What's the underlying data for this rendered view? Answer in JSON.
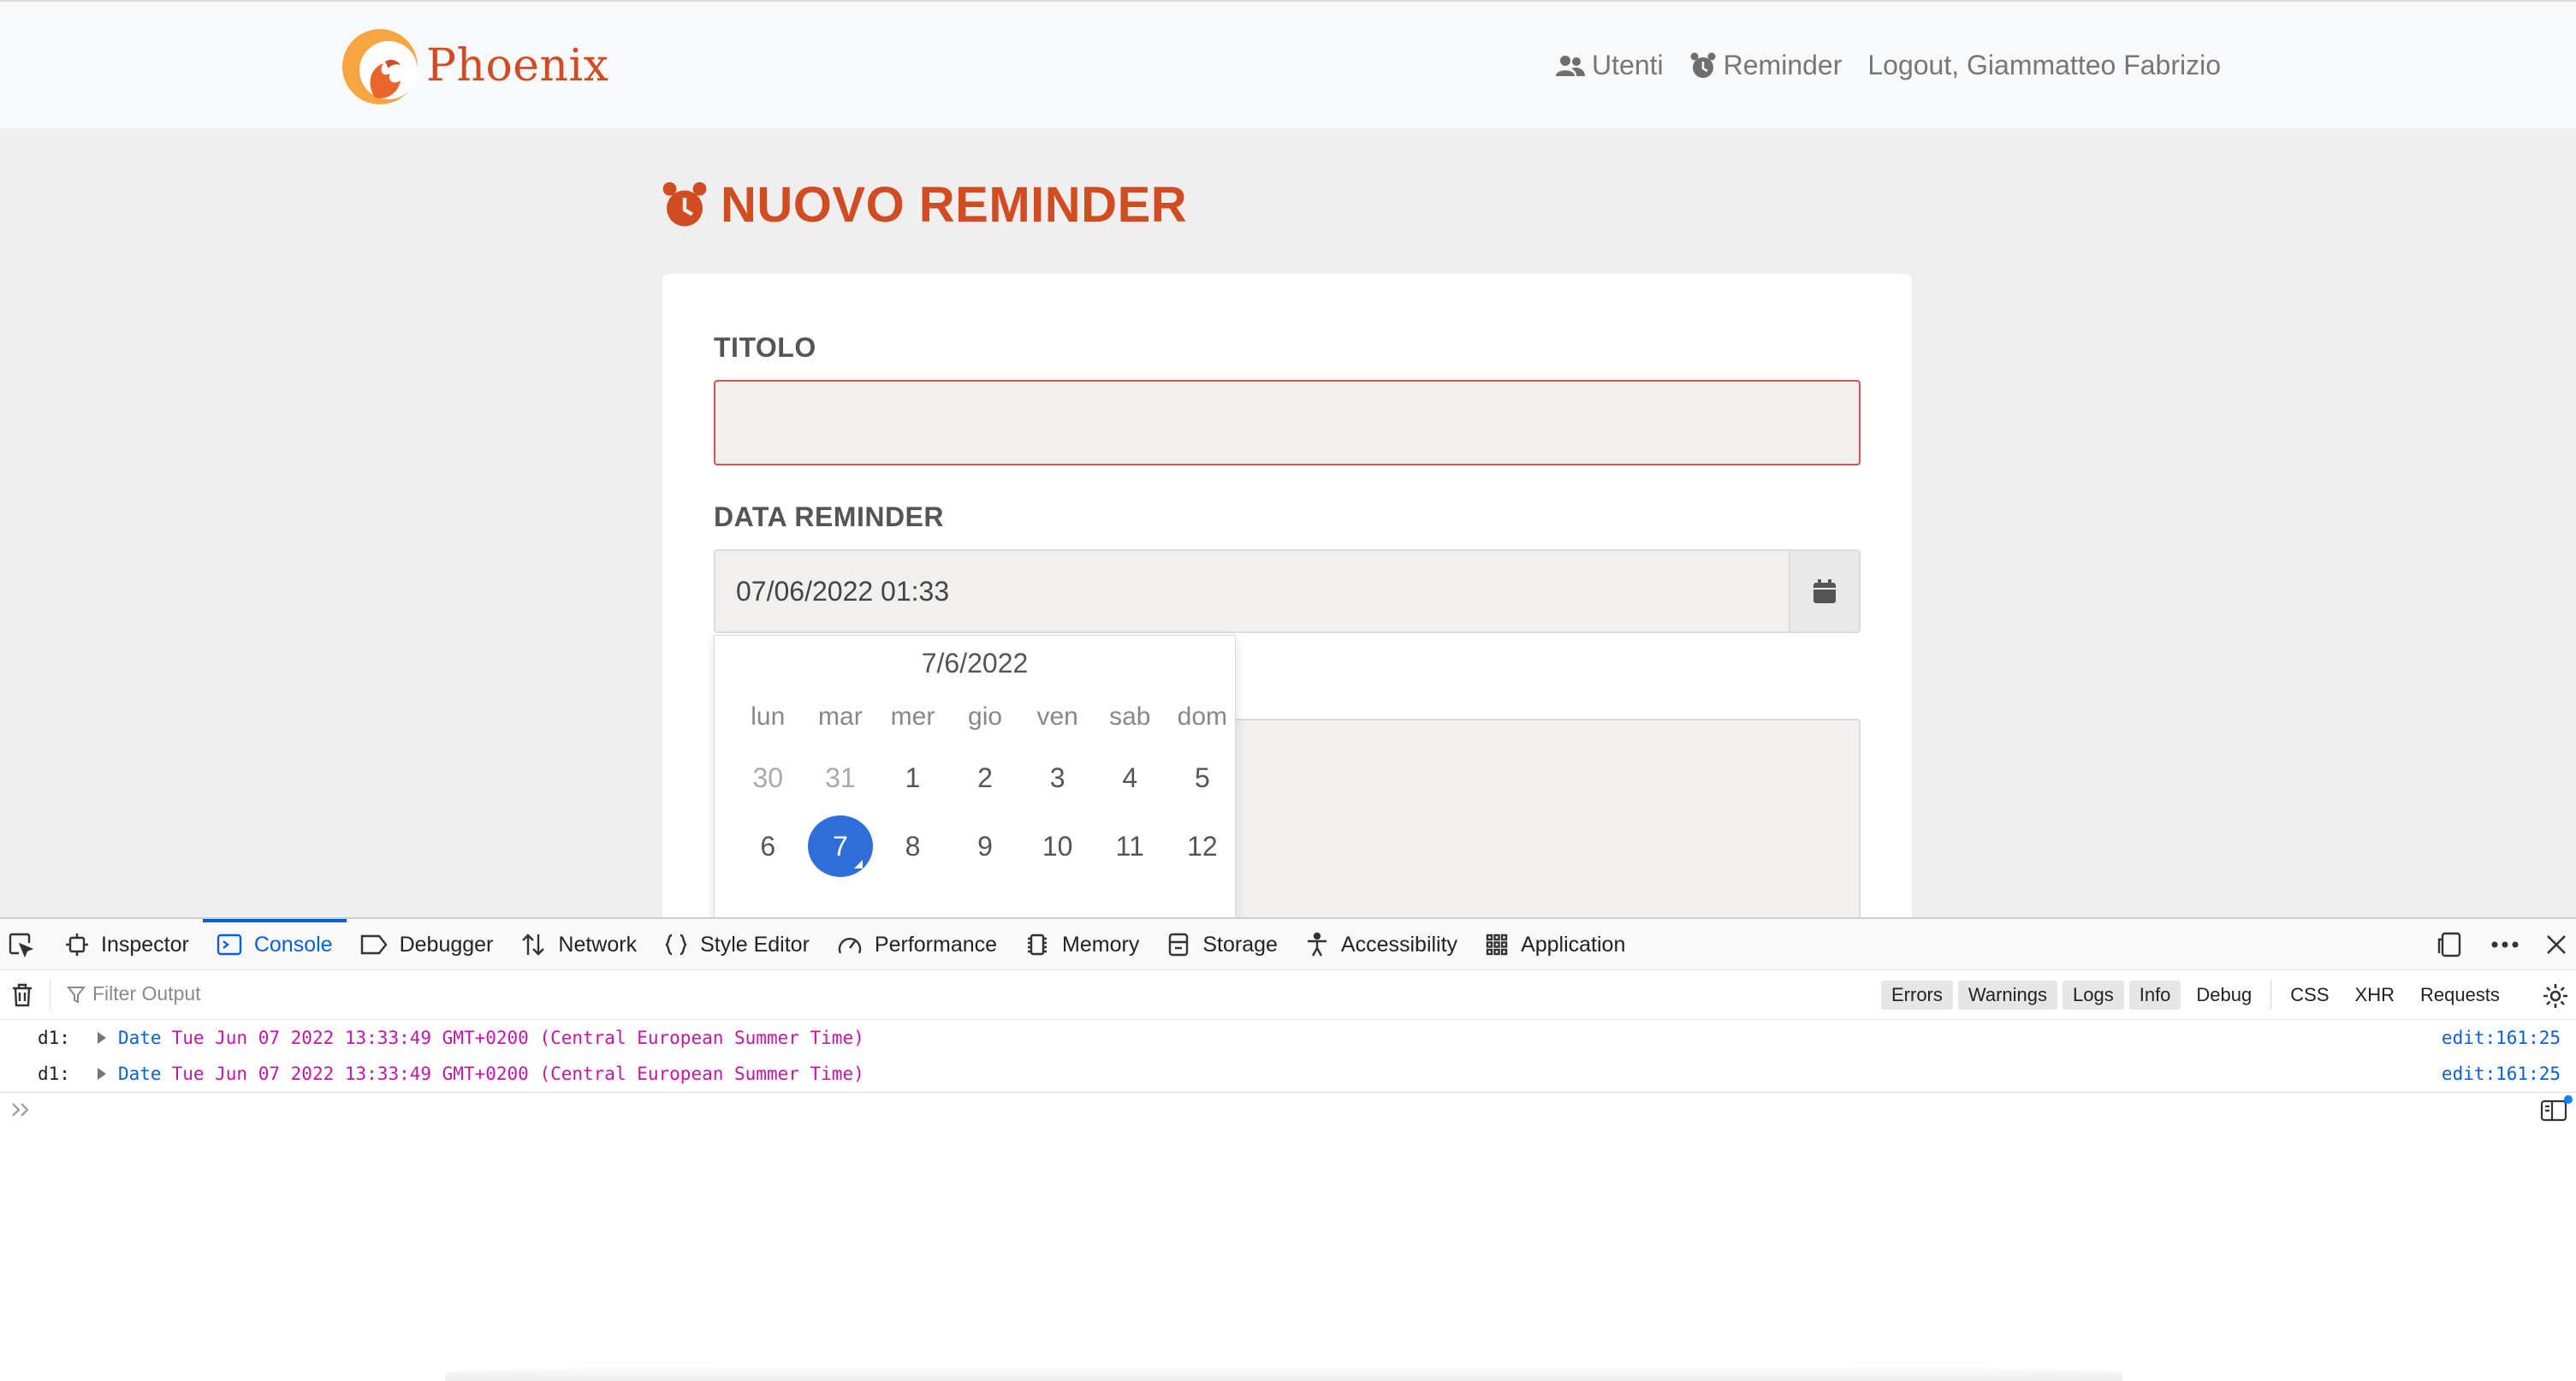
{
  "app": {
    "brand": "Phoenix",
    "nav": {
      "utenti": "Utenti",
      "reminder": "Reminder",
      "logout": "Logout, Giammatteo Fabrizio"
    },
    "page_title": "NUOVO REMINDER",
    "form": {
      "titolo_label": "TITOLO",
      "titolo_value": "",
      "data_label": "DATA REMINDER",
      "data_value": "07/06/2022 01:33"
    },
    "datepicker": {
      "month_label": "7/6/2022",
      "weekdays": [
        "lun",
        "mar",
        "mer",
        "gio",
        "ven",
        "sab",
        "dom"
      ],
      "week1": [
        "30",
        "31",
        "1",
        "2",
        "3",
        "4",
        "5"
      ],
      "week2": [
        "6",
        "7",
        "8",
        "9",
        "10",
        "11",
        "12"
      ],
      "selected_day": "7"
    },
    "colors": {
      "brand": "#d24c22",
      "selected_day": "#2f6ed9",
      "error_border": "#d9534f"
    }
  },
  "devtools": {
    "tabs": [
      "Inspector",
      "Console",
      "Debugger",
      "Network",
      "Style Editor",
      "Performance",
      "Memory",
      "Storage",
      "Accessibility",
      "Application"
    ],
    "active_tab": "Console",
    "filter_placeholder": "Filter Output",
    "levels": [
      "Errors",
      "Warnings",
      "Logs",
      "Info",
      "Debug"
    ],
    "categories": [
      "CSS",
      "XHR",
      "Requests"
    ],
    "logs": [
      {
        "label": "d1:",
        "kind": "Date",
        "value": "Tue Jun 07 2022 13:33:49 GMT+0200 (Central European Summer Time)",
        "source": "edit:161:25"
      },
      {
        "label": "d1:",
        "kind": "Date",
        "value": "Tue Jun 07 2022 13:33:49 GMT+0200 (Central European Summer Time)",
        "source": "edit:161:25"
      }
    ]
  }
}
